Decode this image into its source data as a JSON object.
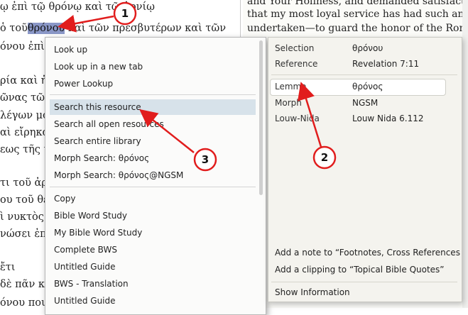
{
  "left_doc": {
    "lines": [
      "ῳ ἐπὶ τῷ θρόνῳ καὶ τῷ ἀρνίῳ",
      "ὁ τοῦ",
      "θρόνου",
      "καὶ τῶν πρεσβυτέρων καὶ τῶν",
      "όνου ἐπὶ τ",
      "ρία καὶ ἡ ε",
      "ῶνας τῶν α",
      "λέγων μο",
      "αὶ εἴρηκα",
      "εως τῆς με",
      "τι τοῦ ἀρν",
      "ου τοῦ θεο",
      "ὶ νυκτὸς ἐ",
      "νώσει ἐπ'",
      "ἔτι",
      "δὲ πᾶν καῦ",
      "όνου ποιμανεῖ αὐτοὺς"
    ]
  },
  "right_doc": {
    "lines": [
      "and Your Holiness, and demanded satisfaction",
      "that my most loyal service has had such an unh",
      "undertaken—to guard the honor of the Roman"
    ]
  },
  "menu": {
    "items": [
      "Look up",
      "Look up in a new tab",
      "Power Lookup",
      "Search this resource",
      "Search all open resources",
      "Search entire library",
      "Morph Search: θρόνος",
      "Morph Search: θρόνος@NGSM",
      "Copy",
      "Bible Word Study",
      "My Bible Word Study",
      "Complete BWS",
      "Untitled Guide",
      "BWS - Translation",
      "Untitled Guide"
    ]
  },
  "info": {
    "selection_label": "Selection",
    "selection_value": "θρόνου",
    "reference_label": "Reference",
    "reference_value": "Revelation 7:11",
    "lemma_label": "Lemma",
    "lemma_value": "θρόνος",
    "morph_label": "Morph",
    "morph_value": "NGSM",
    "louw_label": "Louw-Nida",
    "louw_value": "Louw Nida 6.112",
    "add_note": "Add a note to “Footnotes, Cross References & I",
    "add_clipping": "Add a clipping to “Topical Bible Quotes”",
    "show_info": "Show Information"
  },
  "callouts": [
    "1",
    "2",
    "3"
  ],
  "colors": {
    "annotation": "#e11d1d",
    "selection": "#8a97c7",
    "menu_highlight": "#d7e2ea"
  }
}
